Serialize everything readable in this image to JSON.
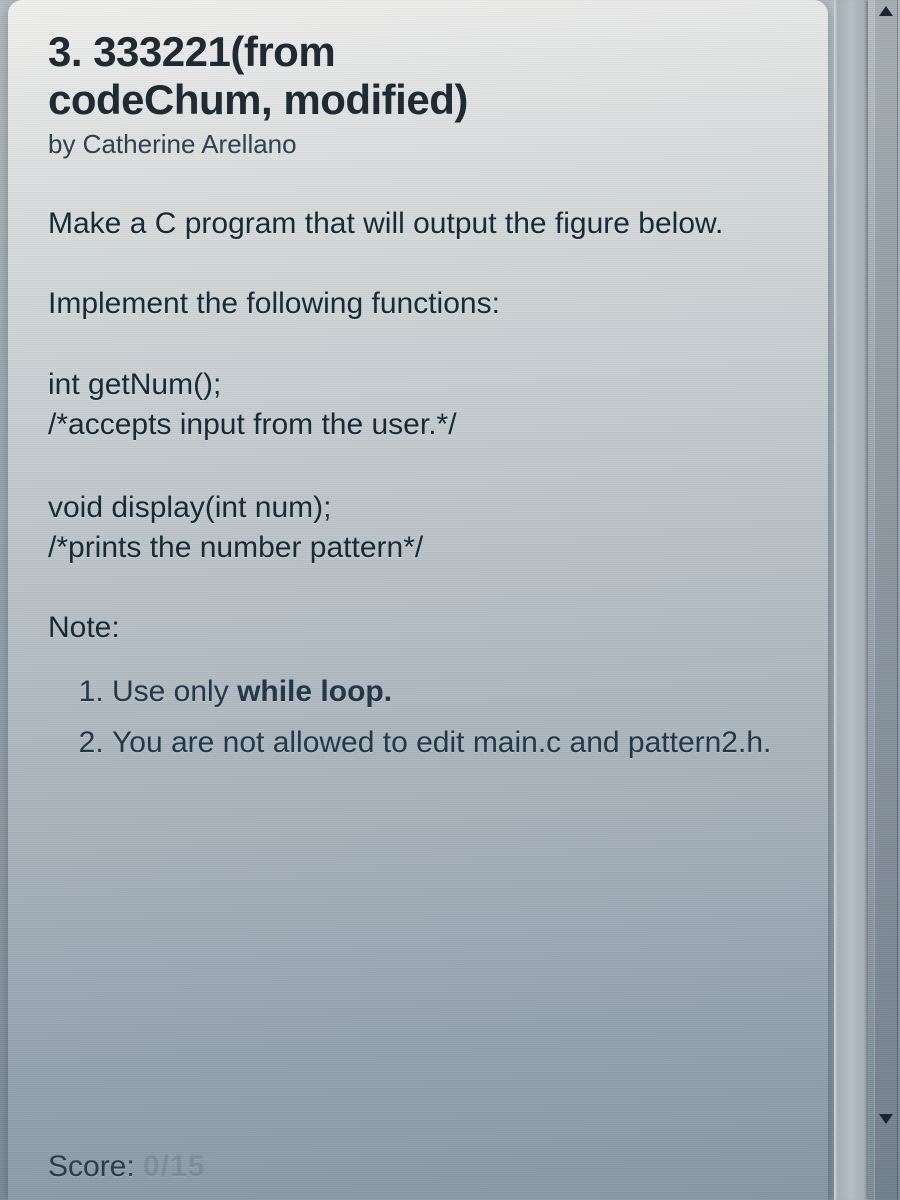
{
  "problem": {
    "title_line1": "3. 333221(from",
    "title_line2": "codeChum, modified)",
    "byline": "by Catherine Arellano",
    "intro": "Make a C program that will output the figure below.",
    "implement_heading": "Implement the following functions:",
    "func1": {
      "signature": "int getNum();",
      "comment": "/*accepts input from the user.*/"
    },
    "func2": {
      "signature": "void display(int num);",
      "comment": "/*prints the number pattern*/"
    },
    "note_label": "Note:",
    "notes": {
      "n1_pre": "Use only ",
      "n1_bold": "while loop.",
      "n2": "You are not allowed to edit main.c and pattern2.h."
    },
    "score_label": "Score: ",
    "score_value": "0/15"
  }
}
